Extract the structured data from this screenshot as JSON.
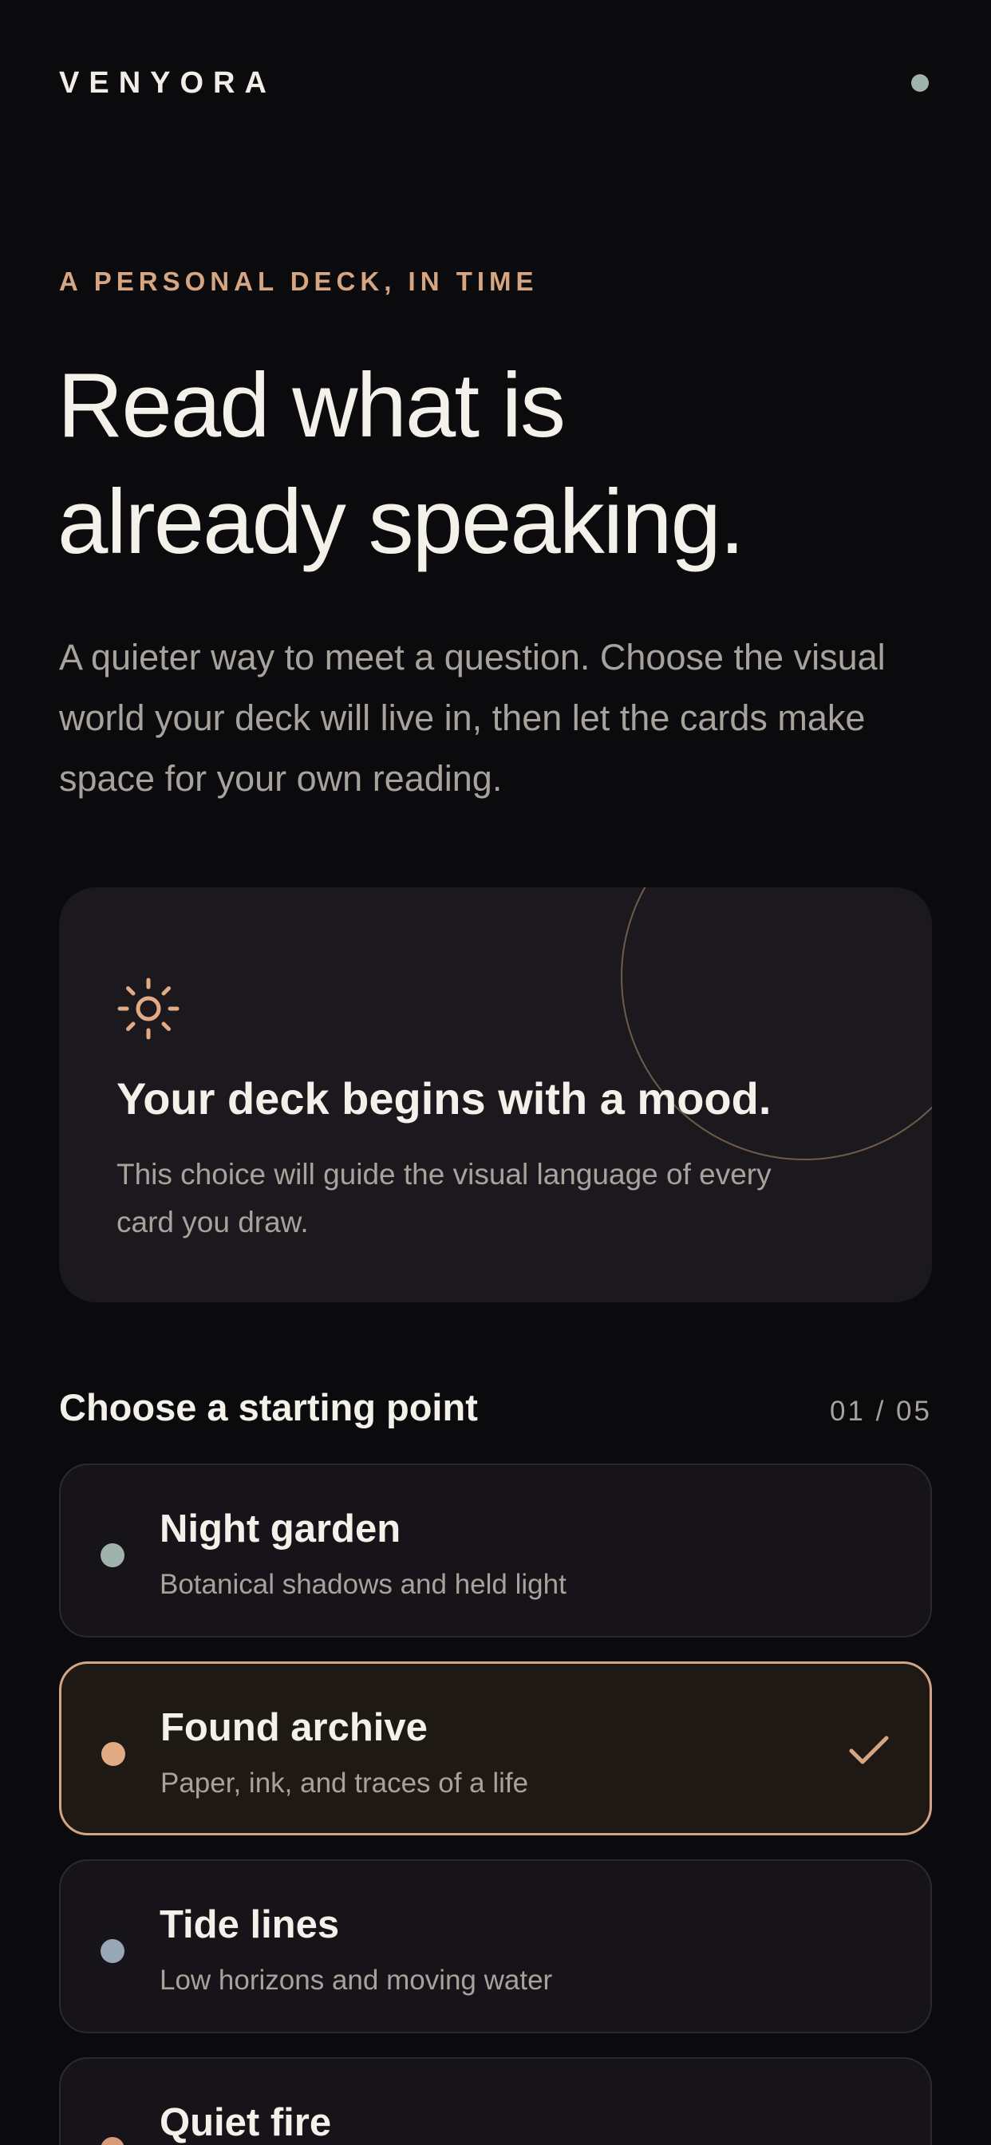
{
  "header": {
    "brand": "VENYORA"
  },
  "hero": {
    "eyebrow": "A PERSONAL DECK, IN TIME",
    "title_line1": "Read what is",
    "title_line2": "already speaking.",
    "subtitle": "A quieter way to meet a question. Choose the visual world your deck will live in, then let the cards make space for your own reading."
  },
  "mood_card": {
    "icon": "sun-icon",
    "title": "Your deck begins with a mood.",
    "description": "This choice will guide the visual language of every card you draw."
  },
  "options_section": {
    "title": "Choose a starting point",
    "step": "01 / 05",
    "options": [
      {
        "title": "Night garden",
        "subtitle": "Botanical shadows and held light",
        "color": "#9fb2ab",
        "selected": false
      },
      {
        "title": "Found archive",
        "subtitle": "Paper, ink, and traces of a life",
        "color": "#e2ab84",
        "selected": true
      },
      {
        "title": "Tide lines",
        "subtitle": "Low horizons and moving water",
        "color": "#97a7b6",
        "selected": false
      },
      {
        "title": "Quiet fire",
        "subtitle": "",
        "color": "#d99a7a",
        "selected": false
      }
    ]
  },
  "colors": {
    "background": "#0b0a0c",
    "accent": "#d6a582",
    "card": "#1b191d",
    "text_muted": "#a8a29c",
    "status_dot": "#9fb2ab"
  }
}
